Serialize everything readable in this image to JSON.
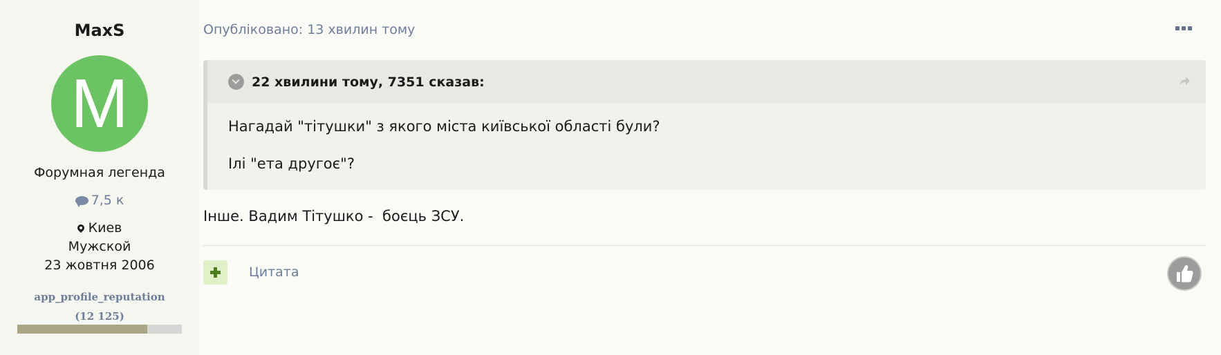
{
  "author": {
    "username": "MaxS",
    "avatar_letter": "M",
    "avatar_color": "#6bc363",
    "rank": "Форумная легенда",
    "posts_icon": "comment-icon",
    "posts_count": "7,5 к",
    "location_icon": "map-marker-icon",
    "location": "Киев",
    "gender": "Мужской",
    "joined": "23 жовтня 2006",
    "reputation_label": "app_profile_reputation",
    "reputation_value": "(12 125)",
    "reputation_fill": 0.79
  },
  "post": {
    "published": "Опубліковано: 13 хвилин тому",
    "menu_icon": "ellipsis-icon",
    "quote": {
      "toggle_icon": "chevron-down-circle-icon",
      "citation": "22 хвилини тому, 7351 сказав:",
      "share_icon": "share-arrow-icon",
      "lines": [
        "Нагадай \"тітушки\" з якого міста київської області були?",
        "Ілі \"ета другоє\"?"
      ]
    },
    "body": "Інше. Вадим Тітушко -  боєць ЗСУ."
  },
  "actions": {
    "multiquote_icon": "plus-icon",
    "quote_label": "Цитата",
    "reaction_icon": "thumbs-up-icon"
  },
  "colors": {
    "accent_text": "#6e7e99",
    "reputation_bar": "#a9a585",
    "plus_button_bg": "#e1f1c7",
    "plus_button_fg": "#4d7d1c",
    "like_button": "#9c9c9a"
  }
}
